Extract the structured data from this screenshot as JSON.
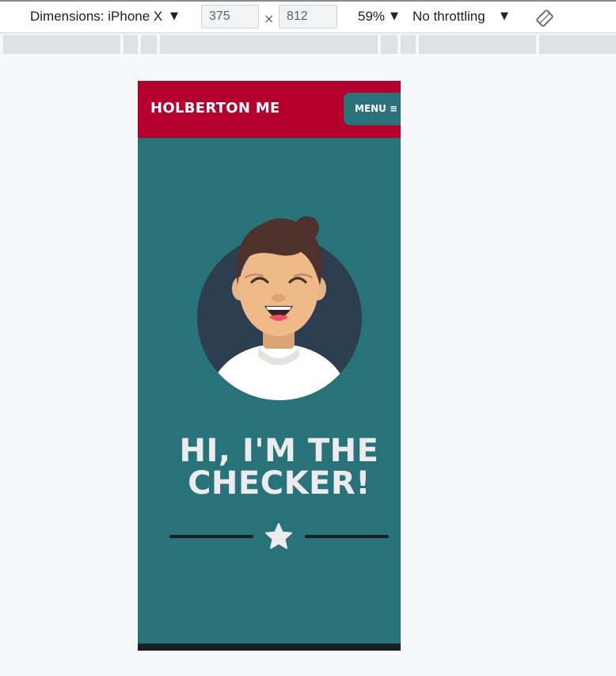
{
  "devtools": {
    "dimensions_label": "Dimensions: iPhone X",
    "width_value": "375",
    "height_value": "812",
    "times_sign": "×",
    "zoom": "59%",
    "throttling": "No throttling",
    "caret": "▼"
  },
  "site": {
    "brand": "HOLBERTON ME",
    "menu_label": "MENU",
    "menu_icon": "≡",
    "hero_line1": "HI, I'M THE",
    "hero_line2": "CHECKER!"
  },
  "colors": {
    "header": "#b5002e",
    "teal": "#28737a",
    "avatar_bg": "#2d3e50",
    "hero_text": "#ececec"
  }
}
